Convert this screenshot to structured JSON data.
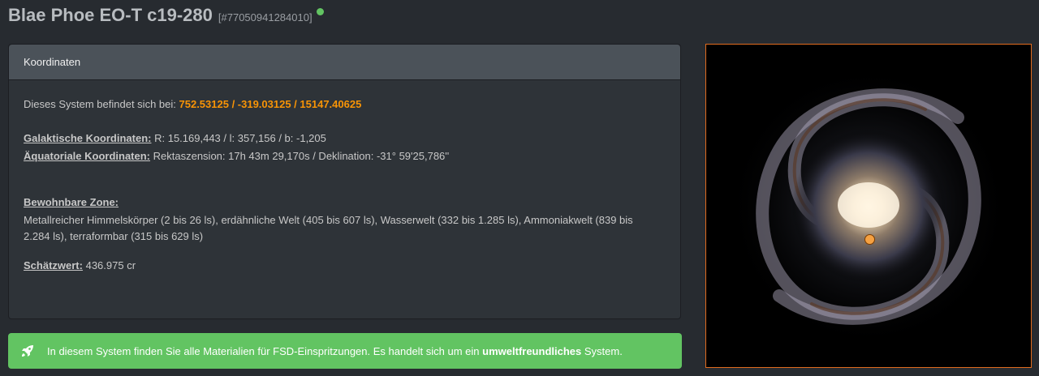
{
  "header": {
    "system_name": "Blae Phoe EO-T c19-280",
    "system_id": "[#77050941284010]"
  },
  "panel": {
    "title": "Koordinaten",
    "location_text": "Dieses System befindet sich bei:",
    "location_value": "752.53125 / -319.03125 / 15147.40625",
    "galactic_label": "Galaktische Koordinaten:",
    "galactic_value": "R: 15.169,443 / l: 357,156 / b: -1,205",
    "equatorial_label": "Äquatoriale Koordinaten:",
    "equatorial_value": "Rektaszension: 17h 43m 29,170s / Deklination: -31° 59'25,786''",
    "habitable_label": "Bewohnbare Zone:",
    "habitable_value": "Metallreicher Himmelskörper (2 bis 26 ls), erdähnliche Welt (405 bis 607 ls), Wasserwelt (332 bis 1.285 ls), Ammoniakwelt (839 bis 2.284 ls), terraformbar (315 bis 629 ls)",
    "estimate_label": "Schätzwert:",
    "estimate_value": "436.975 cr"
  },
  "alert": {
    "text_before": "In diesem System finden Sie alle Materialien für FSD-Einspritzungen. Es handelt sich um ein",
    "text_bold": "umweltfreundliches",
    "text_after": "System.",
    "icon": "rocket-icon"
  },
  "colors": {
    "background": "#272b30",
    "panel": "#2e3338",
    "panel_header": "#4b5259",
    "accent_orange": "#f89406",
    "success_green": "#62c462",
    "map_border": "#e06b1e"
  }
}
